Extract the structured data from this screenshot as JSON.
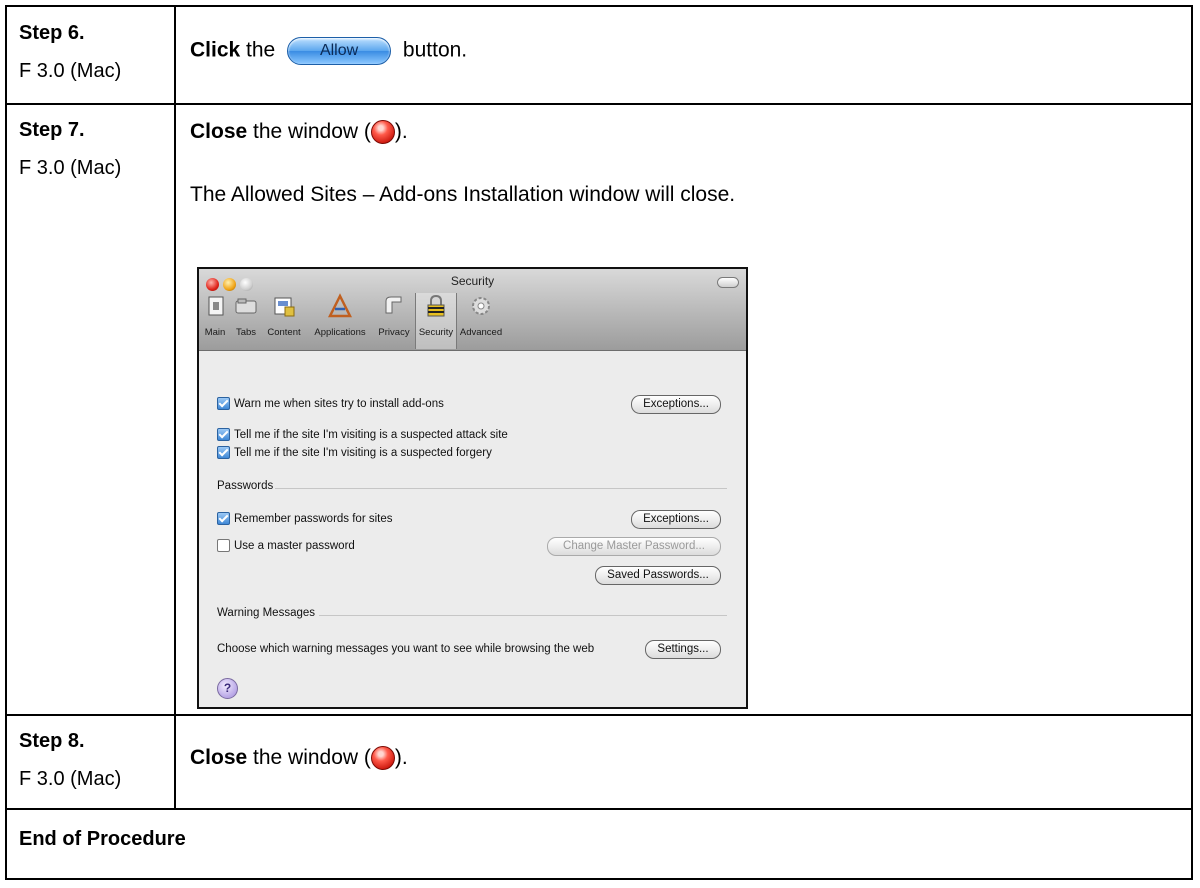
{
  "steps": [
    {
      "title": "Step 6.",
      "sub": "F 3.0 (Mac)",
      "verb": "Click",
      "pre": " the ",
      "button": "Allow",
      "post": " button."
    },
    {
      "title": "Step 7.",
      "sub": "F 3.0 (Mac)",
      "verb": "Close",
      "pre": " the window (",
      "post": ").",
      "note": "The Allowed Sites – Add-ons Installation window will close."
    },
    {
      "title": "Step 8.",
      "sub": "F 3.0 (Mac)",
      "verb": "Close",
      "pre": " the window (",
      "post": ")."
    }
  ],
  "end": "End of Procedure",
  "window": {
    "title": "Security",
    "toolbar": [
      "Main",
      "Tabs",
      "Content",
      "Applications",
      "Privacy",
      "Security",
      "Advanced"
    ],
    "selected": "Security",
    "warn_addons": "Warn me when sites try to install add-ons",
    "exceptions1": "Exceptions...",
    "attack_site": "Tell me if the site I'm visiting is a suspected attack site",
    "forgery": "Tell me if the site I'm visiting is a suspected forgery",
    "passwords_header": "Passwords",
    "remember_pw": "Remember passwords for sites",
    "exceptions2": "Exceptions...",
    "master_pw": "Use a master password",
    "change_master": "Change Master Password...",
    "saved_pw": "Saved Passwords...",
    "warnings_header": "Warning Messages",
    "warnings_text": "Choose which warning messages you want to see while browsing the web",
    "settings": "Settings...",
    "help": "?"
  },
  "checkbox_states": {
    "warn_addons": true,
    "attack_site": true,
    "forgery": true,
    "remember_pw": true,
    "master_pw": false
  }
}
